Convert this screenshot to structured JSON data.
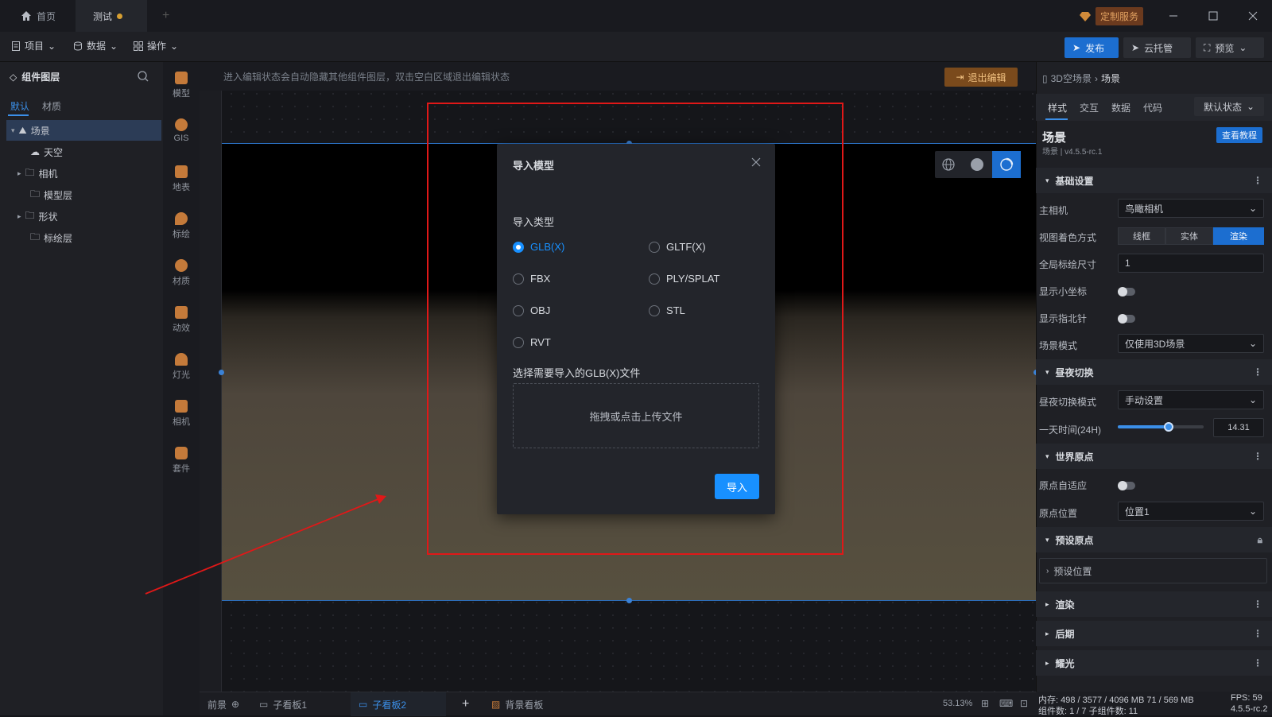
{
  "titlebar": {
    "tabs": [
      {
        "label": "首页",
        "icon": "home-icon"
      },
      {
        "label": "测试",
        "modified": true
      }
    ],
    "add_tab": "+",
    "service_label": "定制服务",
    "window_controls": [
      "minimize",
      "maximize",
      "close"
    ]
  },
  "toolbar": {
    "menus": [
      {
        "label": "项目",
        "icon": "file-icon"
      },
      {
        "label": "数据",
        "icon": "database-icon"
      },
      {
        "label": "操作",
        "icon": "grid-icon"
      }
    ],
    "publish_label": "发布",
    "cloud_label": "云托管",
    "preview_label": "预览"
  },
  "left_panel": {
    "title": "组件图层",
    "tabs": [
      "默认",
      "材质"
    ],
    "tree": [
      {
        "label": "场景",
        "selected": true,
        "expanded": true,
        "level": 0
      },
      {
        "label": "天空",
        "level": 1
      },
      {
        "label": "相机",
        "level": 1,
        "collapsed": true
      },
      {
        "label": "模型层",
        "level": 1
      },
      {
        "label": "形状",
        "level": 1,
        "collapsed": true
      },
      {
        "label": "标绘层",
        "level": 1
      }
    ]
  },
  "icon_column": [
    {
      "label": "模型",
      "color": "#c47a3a"
    },
    {
      "label": "GIS",
      "color": "#c47a3a"
    },
    {
      "label": "地表",
      "color": "#c47a3a"
    },
    {
      "label": "标绘",
      "color": "#c47a3a"
    },
    {
      "label": "材质",
      "color": "#c47a3a"
    },
    {
      "label": "动效",
      "color": "#c47a3a"
    },
    {
      "label": "灯光",
      "color": "#c47a3a"
    },
    {
      "label": "相机",
      "color": "#c47a3a"
    },
    {
      "label": "套件",
      "color": "#c47a3a"
    }
  ],
  "editor": {
    "hint": "进入编辑状态会自动隐藏其他组件图层，双击空白区域退出编辑状态",
    "exit_label": "退出编辑"
  },
  "modal": {
    "title": "导入模型",
    "type_label": "导入类型",
    "options": [
      "GLB(X)",
      "GLTF(X)",
      "FBX",
      "PLY/SPLAT",
      "OBJ",
      "STL",
      "RVT"
    ],
    "selected": "GLB(X)",
    "file_label": "选择需要导入的GLB(X)文件",
    "dropzone_text": "拖拽或点击上传文件",
    "import_label": "导入"
  },
  "right_panel": {
    "breadcrumb": [
      "3D空场景",
      "场景"
    ],
    "tabs": [
      "样式",
      "交互",
      "数据",
      "代码"
    ],
    "state_select": "默认状态",
    "component_title": "场景",
    "component_sub": "场景 | v4.5.5-rc.1",
    "tutorial_label": "查看教程",
    "sections": {
      "basic": "基础设置",
      "daynight": "昼夜切换",
      "origin": "世界原点",
      "preset_origin": "预设原点",
      "preset_position": "预设位置",
      "render": "渲染",
      "post": "后期",
      "glow": "耀光"
    },
    "fields": {
      "main_camera_label": "主相机",
      "main_camera_value": "鸟瞰相机",
      "shading_label": "视图着色方式",
      "shading_options": [
        "线框",
        "实体",
        "渲染"
      ],
      "shading_selected": "渲染",
      "plot_size_label": "全局标绘尺寸",
      "plot_size_value": "1",
      "show_axis_label": "显示小坐标",
      "show_compass_label": "显示指北针",
      "scene_mode_label": "场景模式",
      "scene_mode_value": "仅使用3D场景",
      "daynight_mode_label": "昼夜切换模式",
      "daynight_mode_value": "手动设置",
      "day_time_label": "一天时间(24H)",
      "day_time_value": "14.31",
      "day_time_fraction": 0.596,
      "origin_adapt_label": "原点自适应",
      "origin_position_label": "原点位置",
      "origin_position_value": "位置1"
    }
  },
  "bottom": {
    "tabs": [
      {
        "label": "前景"
      },
      {
        "label": "子看板1"
      },
      {
        "label": "子看板2",
        "active": true
      },
      {
        "label": "背景看板"
      }
    ],
    "add_label": "+",
    "zoom": "53.13%"
  },
  "status": {
    "memory": "内存: 498 / 3577 / 4096 MB  71 / 569 MB",
    "fps": "FPS: 59",
    "components": "组件数: 1 / 7    子组件数: 11",
    "version": "4.5.5-rc.2"
  }
}
